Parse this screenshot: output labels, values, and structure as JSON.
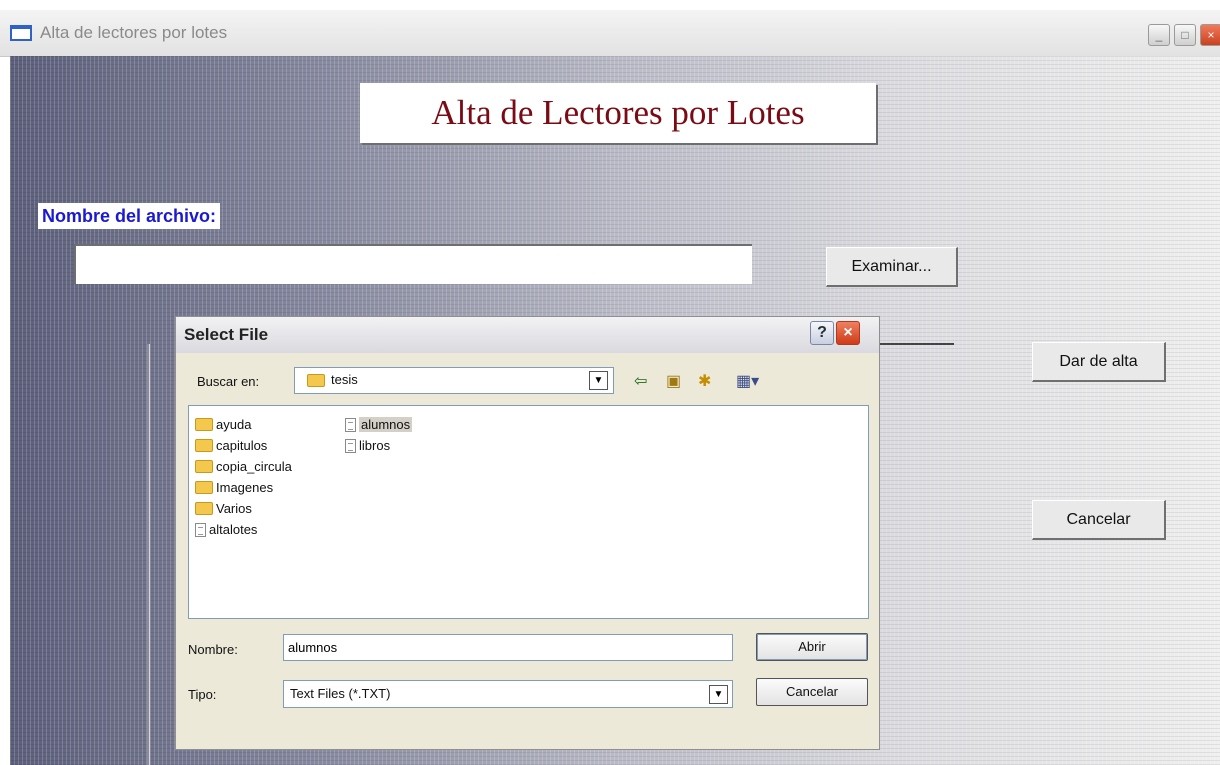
{
  "window": {
    "title": "Alta de lectores por lotes",
    "controls": [
      "_",
      "□",
      "×"
    ]
  },
  "main": {
    "heading": "Alta de Lectores por Lotes",
    "file_label": "Nombre del archivo:",
    "file_value": "",
    "browse_button": "Examinar...",
    "submit_button": "Dar de alta",
    "cancel_button": "Cancelar",
    "heading_color": "#7a0b14",
    "label_color": "#1a1ad0"
  },
  "dialog": {
    "title": "Select File",
    "help": "?",
    "close": "×",
    "look_in_label": "Buscar en:",
    "look_in_value": "tesis",
    "toolbar_icons": [
      "back-icon",
      "up-folder-icon",
      "new-folder-icon",
      "views-icon"
    ],
    "items": [
      {
        "name": "ayuda",
        "type": "folder"
      },
      {
        "name": "capitulos",
        "type": "folder"
      },
      {
        "name": "copia_circula",
        "type": "folder"
      },
      {
        "name": "Imagenes",
        "type": "folder"
      },
      {
        "name": "Varios",
        "type": "folder"
      },
      {
        "name": "altalotes",
        "type": "file"
      },
      {
        "name": "alumnos",
        "type": "file",
        "selected": true
      },
      {
        "name": "libros",
        "type": "file"
      }
    ],
    "name_label": "Nombre:",
    "name_value": "alumnos",
    "type_label": "Tipo:",
    "type_value": "Text Files (*.TXT)",
    "open_button": "Abrir",
    "cancel_button": "Cancelar"
  }
}
